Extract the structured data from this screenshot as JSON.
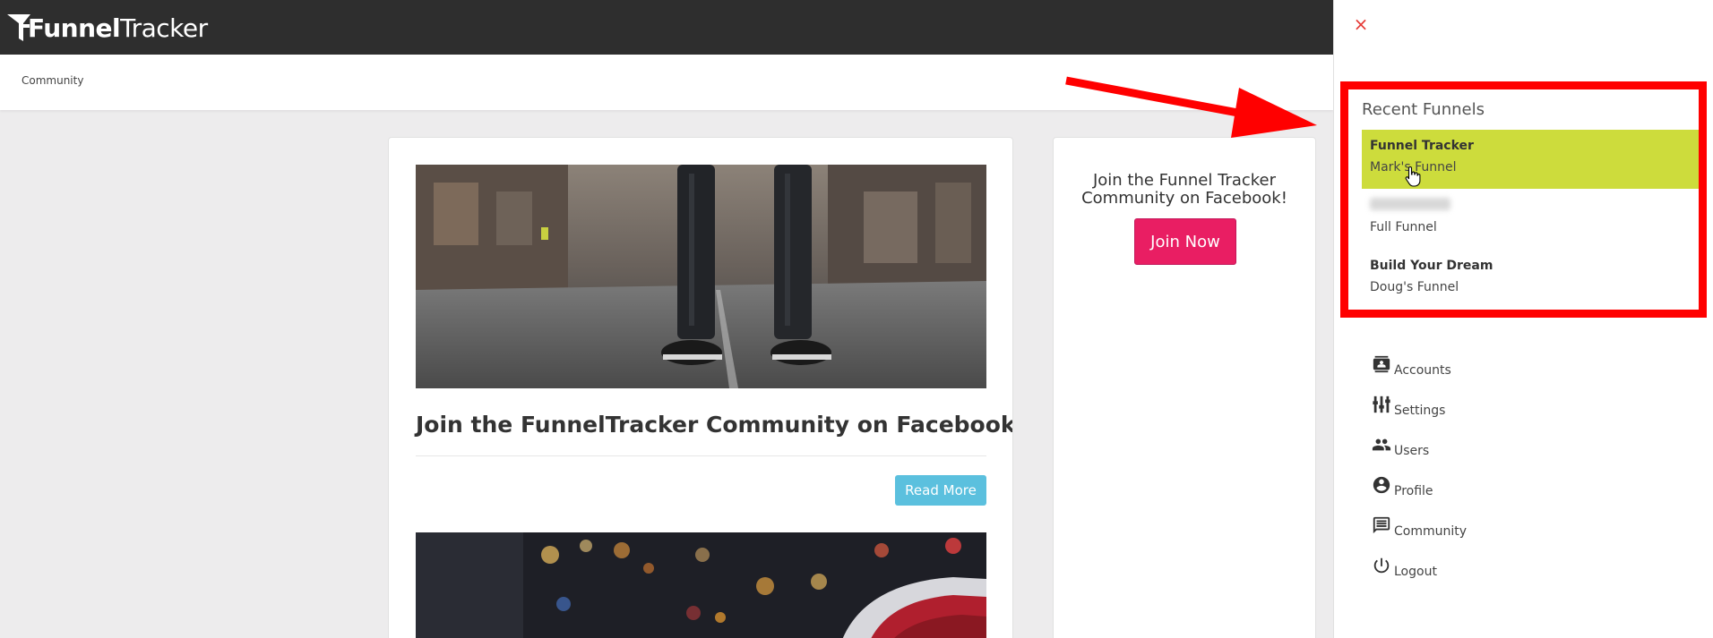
{
  "app": {
    "logo_word1": "Funnel",
    "logo_word2": "Tracker",
    "breadcrumb": "Community"
  },
  "post": {
    "title": "Join the FunnelTracker Community on Facebook",
    "read_more_label": "Read More"
  },
  "sidebar_card": {
    "text": "Join the Funnel Tracker Community on Facebook!",
    "button_label": "Join Now"
  },
  "drawer": {
    "close_label": "×",
    "recent_title": "Recent Funnels",
    "funnels": [
      {
        "name": "Funnel Tracker",
        "subtitle": "Mark's Funnel",
        "active": true
      },
      {
        "name": "",
        "subtitle": "Full Funnel",
        "active": false
      },
      {
        "name": "Build Your Dream",
        "subtitle": "Doug's Funnel",
        "active": false
      }
    ],
    "menu": [
      {
        "label": "Accounts",
        "icon": "contact-card-icon"
      },
      {
        "label": "Settings",
        "icon": "sliders-icon"
      },
      {
        "label": "Users",
        "icon": "people-icon"
      },
      {
        "label": "Profile",
        "icon": "account-circle-icon"
      },
      {
        "label": "Community",
        "icon": "forum-icon"
      },
      {
        "label": "Logout",
        "icon": "power-icon"
      }
    ]
  },
  "colors": {
    "topbar": "#2e2e2e",
    "active_funnel": "#cddc3c",
    "highlight": "#ff0000",
    "join_button": "#e91e63",
    "read_more_button": "#5bc0de",
    "close_icon": "#e53935"
  }
}
